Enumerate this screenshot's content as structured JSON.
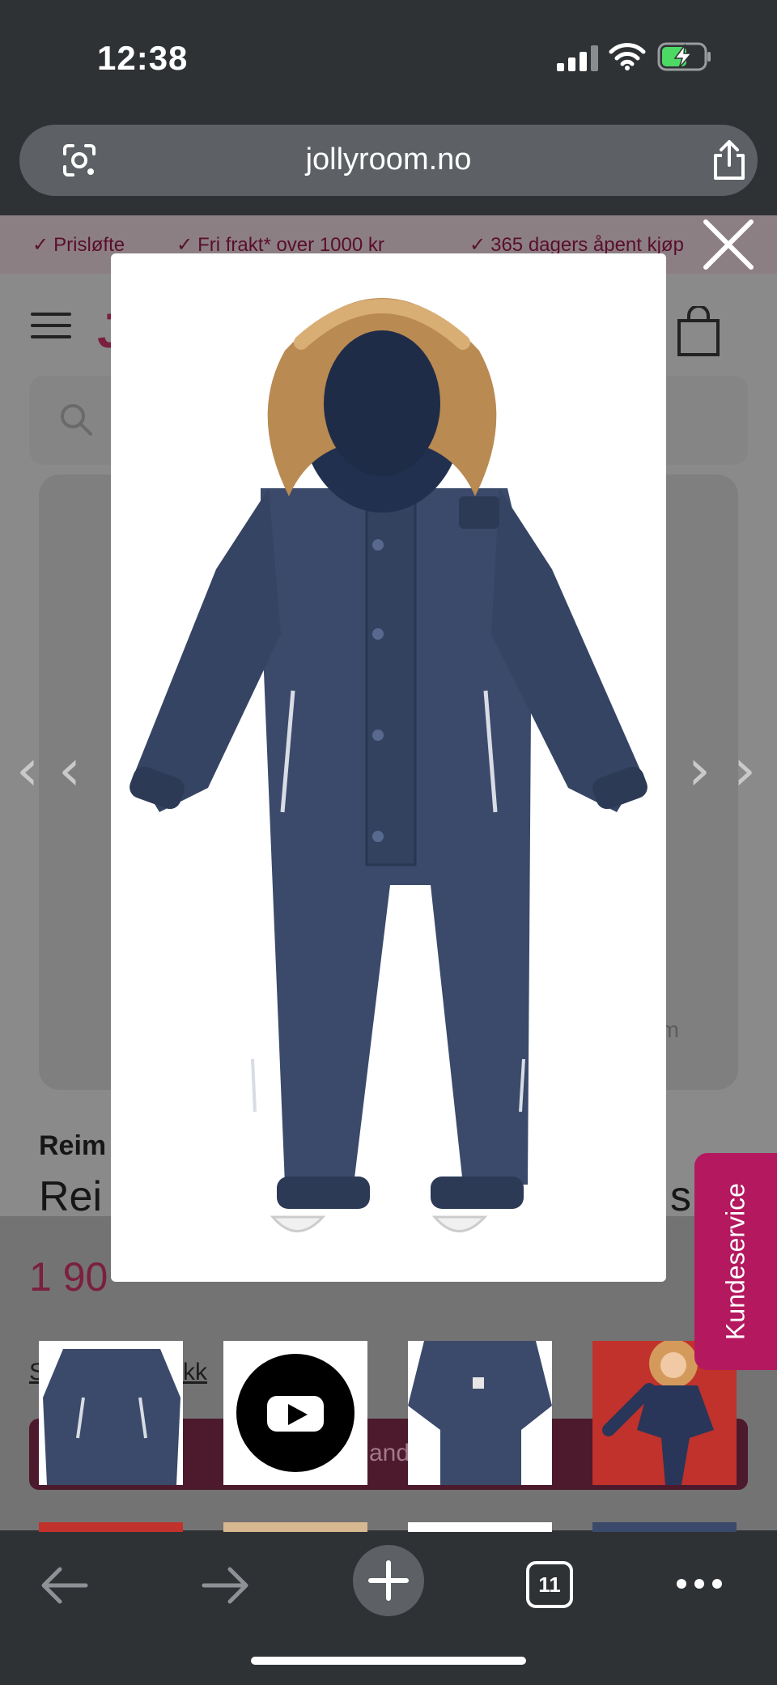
{
  "status_bar": {
    "time": "12:38"
  },
  "browser": {
    "url": "jollyroom.no",
    "open_tabs": "11"
  },
  "site": {
    "usps": [
      {
        "check": "✓",
        "text": "Prisløfte"
      },
      {
        "check": "✓",
        "text": "Fri frakt* over 1000 kr"
      },
      {
        "check": "✓",
        "text": "365 dagers åpent kjøp"
      }
    ],
    "gallery_domain_tail": "om",
    "brand_partial": "Reim",
    "title_partial": "Rei",
    "title_tail": "s,",
    "price_partial": "1 90",
    "size_link_partial": "S",
    "size_link_tail": "kk",
    "cta_label_partial": "andl"
  },
  "lightbox": {
    "product_image": "navy blue winter overall with fur-trimmed hood",
    "thumbnails": [
      {
        "type": "image",
        "subject": "overall front"
      },
      {
        "type": "video",
        "subject": "youtube-play"
      },
      {
        "type": "image",
        "subject": "overall back"
      },
      {
        "type": "image",
        "subject": "child wearing overall"
      }
    ]
  },
  "customer_service": {
    "label": "Kundeservice"
  },
  "colors": {
    "chrome": "#2f3235",
    "urlbar": "#5d6165",
    "brand": "#7b1f3f",
    "kundeservice": "#b4195f",
    "garment": "#3b4a6b"
  }
}
